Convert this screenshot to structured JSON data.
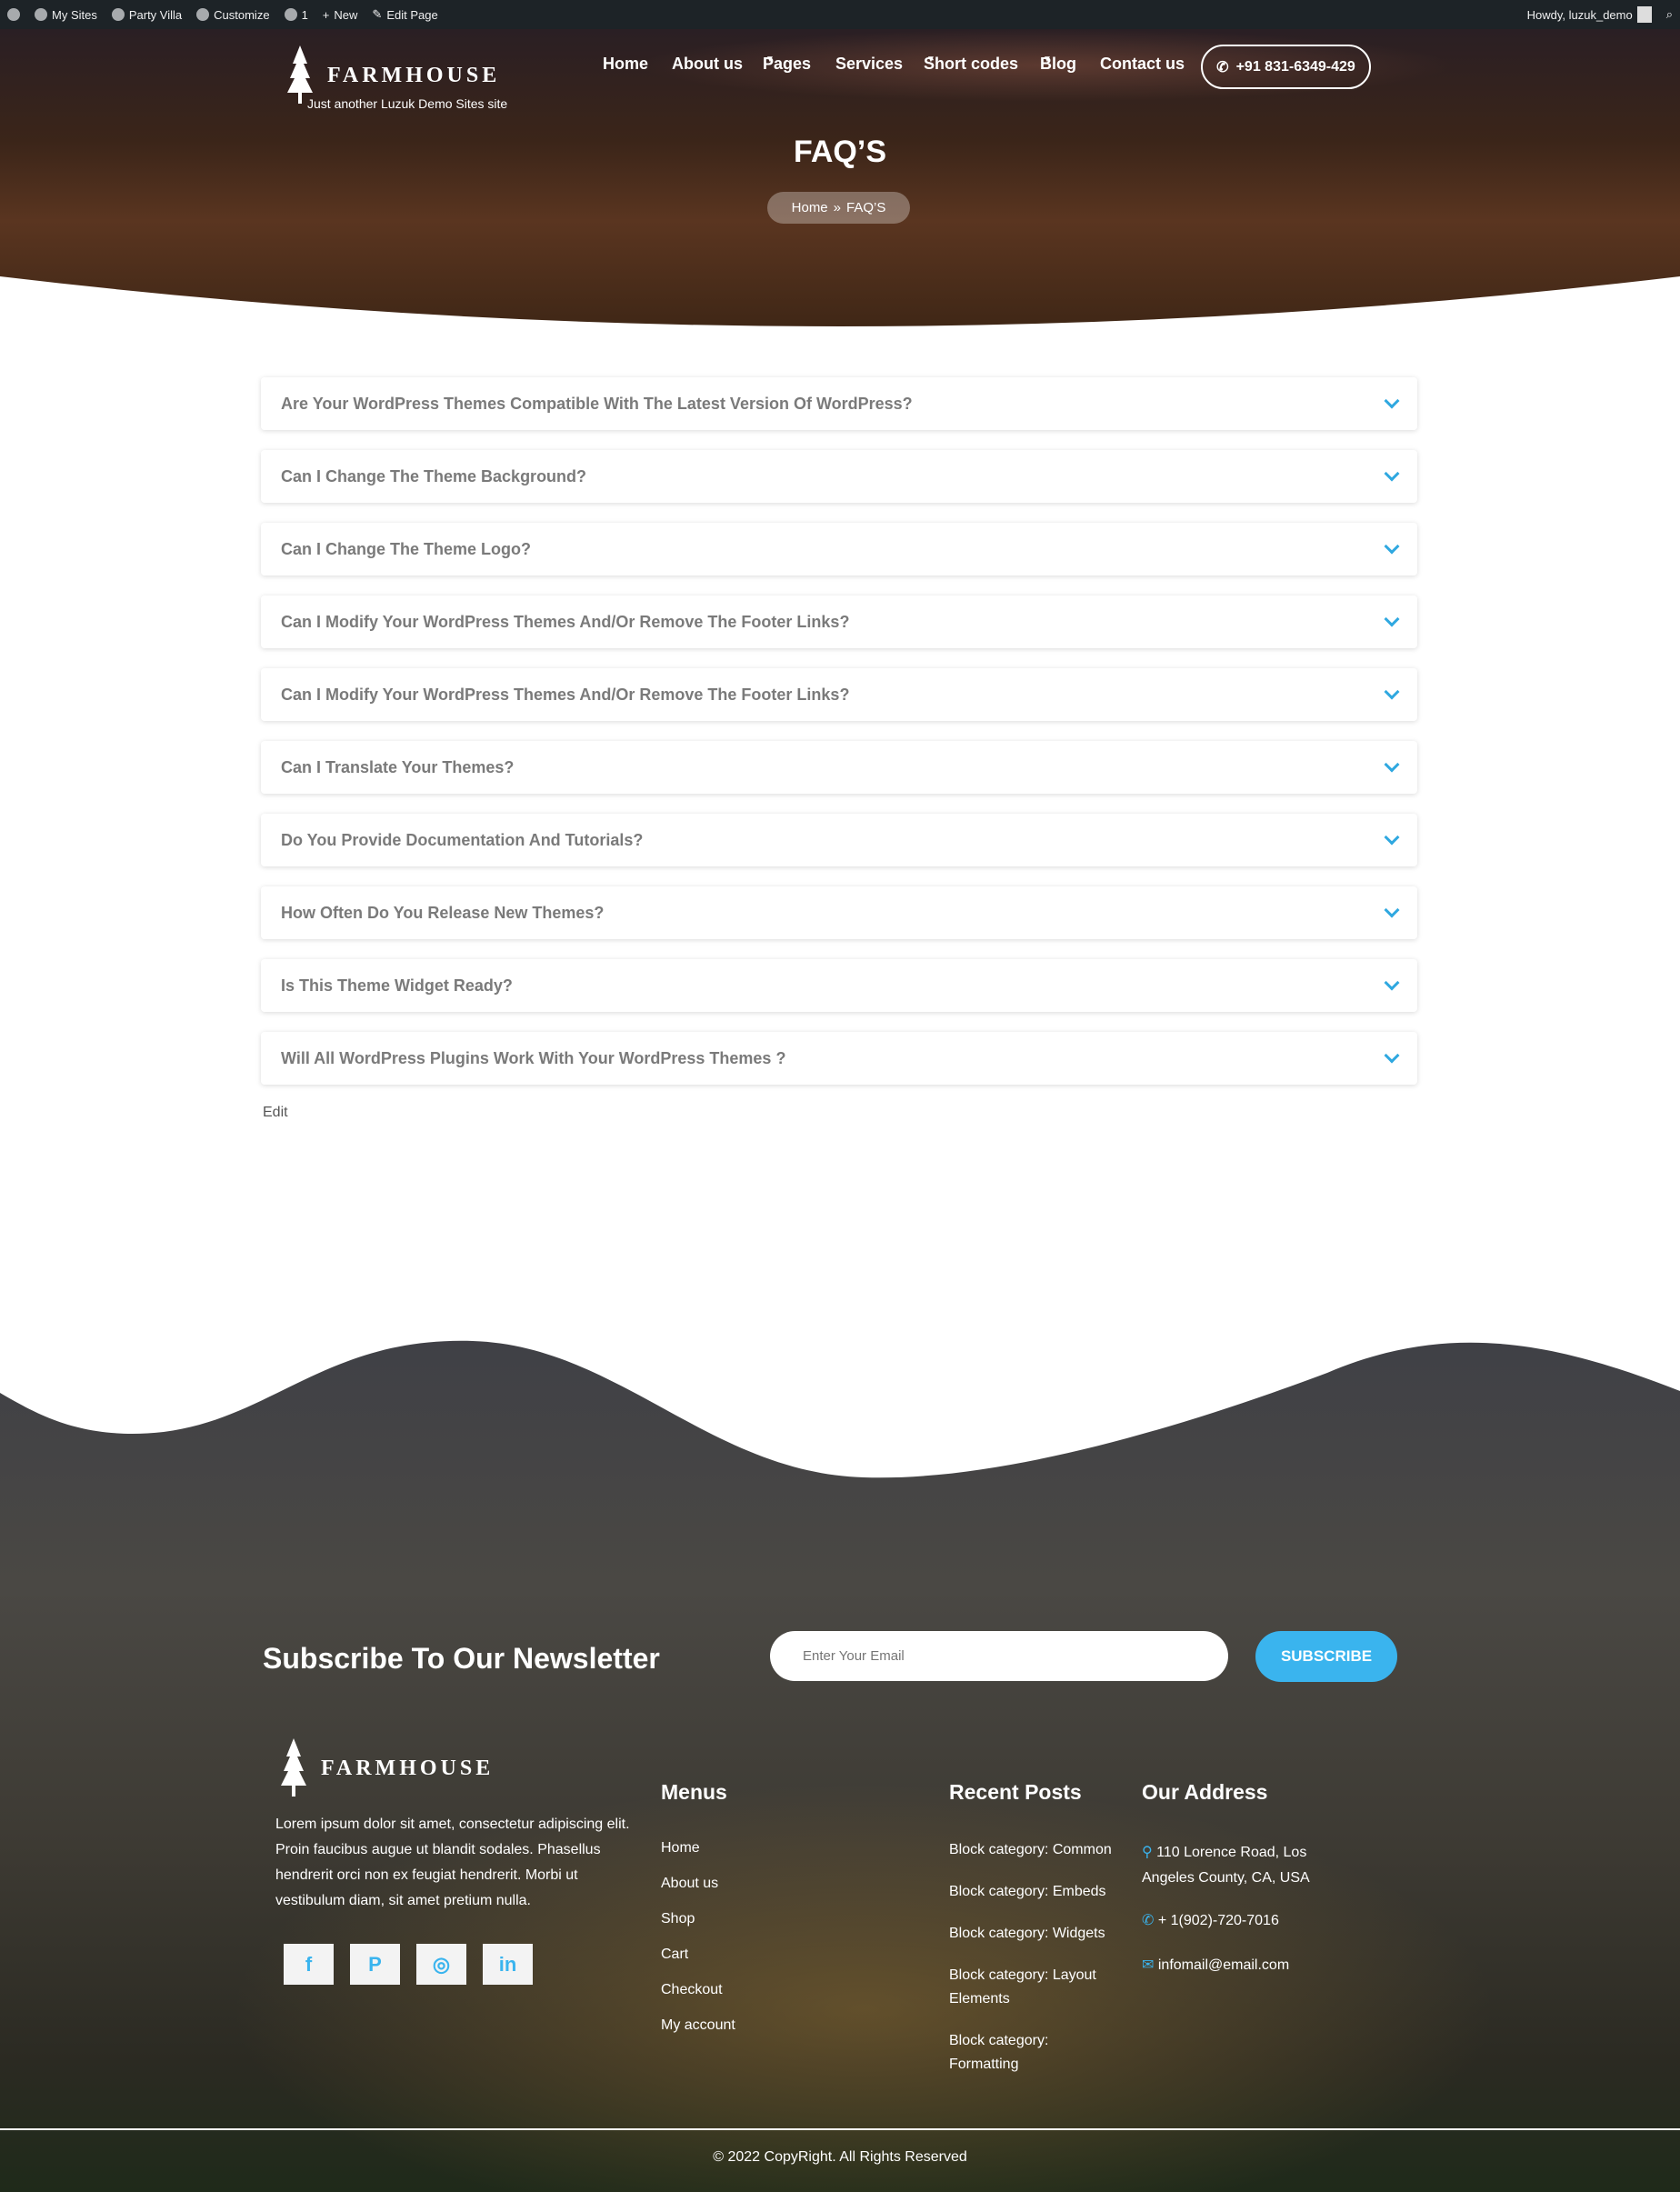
{
  "adminbar": {
    "items": [
      "My Sites",
      "Party Villa",
      "Customize",
      "1",
      "New",
      "Edit Page"
    ],
    "howdy": "Howdy, luzuk_demo"
  },
  "header": {
    "logo": "FARMHOUSE",
    "tagline": "Just another Luzuk Demo Sites site",
    "nav": [
      {
        "label": "Home",
        "dropdown": false
      },
      {
        "label": "About us",
        "dropdown": false
      },
      {
        "label": "Pages",
        "dropdown": true
      },
      {
        "label": "Services",
        "dropdown": false
      },
      {
        "label": "Short codes",
        "dropdown": true
      },
      {
        "label": "Blog",
        "dropdown": true
      },
      {
        "label": "Contact us",
        "dropdown": false
      }
    ],
    "phone": "+91 831-6349-429"
  },
  "hero": {
    "title": "FAQ’S",
    "breadcrumb": [
      "Home",
      "FAQ’S"
    ],
    "separator": "»"
  },
  "faq": [
    "Are Your WordPress Themes Compatible With The Latest Version Of WordPress?",
    "Can I Change The Theme Background?",
    "Can I Change The Theme Logo?",
    "Can I Modify Your WordPress Themes And/Or Remove The Footer Links?",
    "Can I Modify Your WordPress Themes And/Or Remove The Footer Links?",
    "Can I Translate Your Themes?",
    "Do You Provide Documentation And Tutorials?",
    "How Often Do You Release New Themes?",
    "Is This Theme Widget Ready?",
    "Will All WordPress Plugins Work With Your WordPress Themes ?"
  ],
  "edit": "Edit",
  "footer": {
    "newsletter_title": "Subscribe To Our Newsletter",
    "email_placeholder": "Enter Your Email",
    "subscribe": "SUBSCRIBE",
    "logo": "FARMHOUSE",
    "about": "Lorem ipsum dolor sit amet, consectetur adipiscing elit. Proin faucibus augue ut blandit sodales. Phasellus hendrerit orci non ex feugiat hendrerit. Morbi ut vestibulum diam, sit amet pretium nulla.",
    "social": [
      {
        "icon": "facebook-icon",
        "glyph": "f"
      },
      {
        "icon": "pinterest-icon",
        "glyph": "P"
      },
      {
        "icon": "instagram-icon",
        "glyph": "◎"
      },
      {
        "icon": "linkedin-icon",
        "glyph": "in"
      }
    ],
    "menus_title": "Menus",
    "menus": [
      "Home",
      "About us",
      "Shop",
      "Cart",
      "Checkout",
      "My account"
    ],
    "posts_title": "Recent Posts",
    "posts": [
      "Block category: Common",
      "Block category: Embeds",
      "Block category: Widgets",
      "Block category: Layout Elements",
      "Block category: Formatting"
    ],
    "address_title": "Our Address",
    "address": "110 Lorence Road, Los Angeles County, CA, USA",
    "phone": "+ 1(902)-720-7016",
    "email": "infomail@email.com",
    "copyright": "© 2022 CopyRight. All Rights Reserved"
  },
  "colors": {
    "accent": "#3ab4ee",
    "admin_bar": "#1d2327",
    "faq_text": "#7a7a7a"
  }
}
